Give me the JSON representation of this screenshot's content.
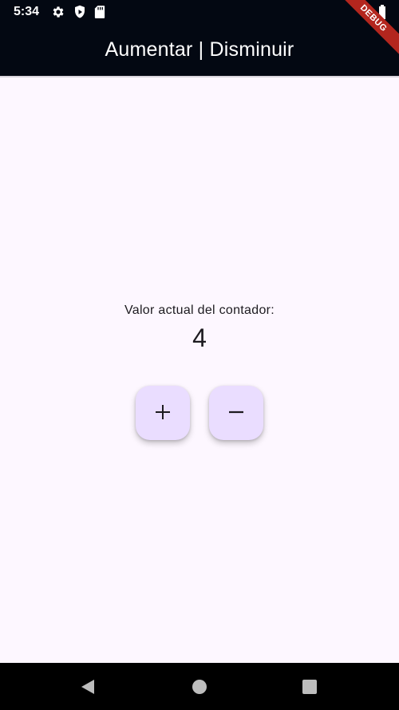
{
  "status_bar": {
    "time": "5:34",
    "left_icons": [
      "settings-icon",
      "shield-play-icon",
      "sd-card-icon"
    ],
    "right_icons": [
      "wifi-icon",
      "battery-icon"
    ]
  },
  "app_bar": {
    "title": "Aumentar | Disminuir",
    "background": "#030812"
  },
  "debug_banner": "DEBUG",
  "counter": {
    "label": "Valor actual del contador:",
    "value": "4"
  },
  "buttons": {
    "increment": {
      "icon": "plus-icon",
      "color": "#eaddff"
    },
    "decrement": {
      "icon": "minus-icon",
      "color": "#eaddff"
    }
  },
  "nav_bar": {
    "buttons": [
      "back-icon",
      "home-icon",
      "recents-icon"
    ]
  },
  "colors": {
    "page_background": "#fdf7ff",
    "fab_background": "#eaddff",
    "debug_banner": "#b3261e"
  }
}
